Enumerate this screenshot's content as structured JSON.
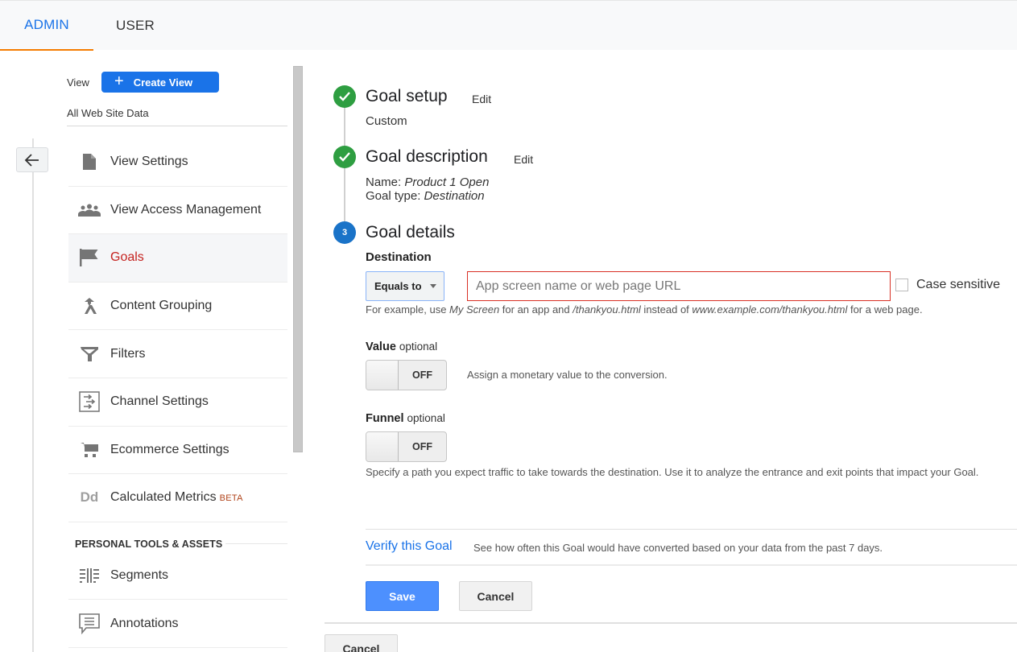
{
  "tabs": [
    {
      "label": "ADMIN",
      "active": true
    },
    {
      "label": "USER",
      "active": false
    }
  ],
  "colors": {
    "accent": "#1a73e8",
    "tab_indicator": "#f57c00",
    "active_nav": "#c5221f",
    "step_done": "#2e9e41",
    "step_current": "#1a73c8",
    "error_border": "#d93025",
    "save_button": "#4d90fe"
  },
  "sidebar": {
    "back_icon": "arrow-left-icon",
    "view_label": "View",
    "create_view_label": "Create View",
    "view_name": "All Web Site Data",
    "items": [
      {
        "label": "View Settings",
        "icon": "document-icon",
        "active": false
      },
      {
        "label": "View Access Management",
        "icon": "people-icon",
        "active": false
      },
      {
        "label": "Goals",
        "icon": "flag-icon",
        "active": true
      },
      {
        "label": "Content Grouping",
        "icon": "merge-icon",
        "active": false
      },
      {
        "label": "Filters",
        "icon": "funnel-icon",
        "active": false
      },
      {
        "label": "Channel Settings",
        "icon": "channel-arrows-icon",
        "active": false
      },
      {
        "label": "Ecommerce Settings",
        "icon": "cart-icon",
        "active": false
      },
      {
        "label": "Calculated Metrics",
        "badge": "BETA",
        "icon": "dd-icon",
        "active": false
      }
    ],
    "section_header": "PERSONAL TOOLS & ASSETS",
    "personal_items": [
      {
        "label": "Segments",
        "icon": "segments-icon"
      },
      {
        "label": "Annotations",
        "icon": "comment-icon"
      }
    ]
  },
  "steps": [
    {
      "number": "1",
      "status": "done",
      "title": "Goal setup",
      "edit_label": "Edit",
      "summary": "Custom"
    },
    {
      "number": "2",
      "status": "done",
      "title": "Goal description",
      "edit_label": "Edit",
      "name_label": "Name:",
      "name_value": "Product 1 Open",
      "type_label": "Goal type:",
      "type_value": "Destination"
    },
    {
      "number": "3",
      "status": "current",
      "title": "Goal details"
    }
  ],
  "details": {
    "destination_label": "Destination",
    "match_type": "Equals to",
    "url_placeholder": "App screen name or web page URL",
    "url_value": "",
    "case_sensitive_label": "Case sensitive",
    "case_sensitive_checked": false,
    "hint": {
      "p1": "For example, use ",
      "e1": "My Screen",
      "p2": " for an app and ",
      "e2": "/thankyou.html",
      "p3": " instead of ",
      "e3": "www.example.com/thankyou.html",
      "p4": " for a web page."
    },
    "value": {
      "label": "Value",
      "optional": "optional",
      "state": "OFF",
      "description": "Assign a monetary value to the conversion."
    },
    "funnel": {
      "label": "Funnel",
      "optional": "optional",
      "state": "OFF",
      "description": "Specify a path you expect traffic to take towards the destination. Use it to analyze the entrance and exit points that impact your Goal."
    },
    "verify_link": "Verify this Goal",
    "verify_description": "See how often this Goal would have converted based on your data from the past 7 days.",
    "save_label": "Save",
    "cancel_label": "Cancel"
  },
  "footer": {
    "cancel_label": "Cancel"
  }
}
